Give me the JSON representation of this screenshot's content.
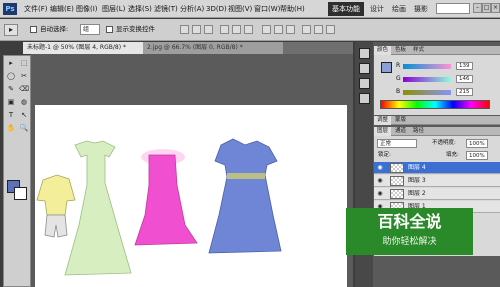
{
  "app": {
    "logo": "Ps"
  },
  "menu": [
    "文件(F)",
    "编辑(E)",
    "图像(I)",
    "图层(L)",
    "选择(S)",
    "滤镜(T)",
    "分析(A)",
    "3D(D)",
    "视图(V)",
    "窗口(W)",
    "帮助(H)"
  ],
  "menubar": {
    "zoom": "50%",
    "workspaces": {
      "active": "基本功能",
      "others": [
        "设计",
        "绘画",
        "摄影"
      ]
    },
    "window_buttons": [
      "–",
      "□",
      "×"
    ]
  },
  "options": {
    "auto_select_label": "自动选择:",
    "auto_select_value": "组",
    "show_transform_label": "显示变换控件"
  },
  "tabs": [
    "未标题-1 @ 50% (图层 4, RGB/8) *",
    "2.jpg @ 66.7% (图层 0, RGB/8) *"
  ],
  "tools": [
    "▸",
    "⬚",
    "◯",
    "✂",
    "✎",
    "⌫",
    "▣",
    "◍",
    "T",
    "↖",
    "✋",
    "🔍"
  ],
  "colors": {
    "foreground": "#5a73b8",
    "background": "#ffffff",
    "panel_swatch": "#8ba0d6"
  },
  "color_panel": {
    "tabs": [
      "颜色",
      "色板",
      "样式"
    ],
    "channels": [
      {
        "label": "R",
        "value": "139"
      },
      {
        "label": "G",
        "value": "146"
      },
      {
        "label": "B",
        "value": "215"
      }
    ]
  },
  "adjust_panel": {
    "tabs": [
      "调整",
      "蒙版"
    ]
  },
  "layers_panel": {
    "tabs": [
      "图层",
      "通道",
      "路径"
    ],
    "blend_mode": "正常",
    "opacity_label": "不透明度:",
    "opacity": "100%",
    "lock_label": "锁定:",
    "fill_label": "填充:",
    "fill": "100%",
    "layers": [
      {
        "name": "图层 4",
        "selected": true
      },
      {
        "name": "图层 3",
        "selected": false
      },
      {
        "name": "图层 2",
        "selected": false
      },
      {
        "name": "图层 1",
        "selected": false
      }
    ]
  },
  "watermark": {
    "title": "百科全说",
    "subtitle": "助你轻松解决"
  }
}
